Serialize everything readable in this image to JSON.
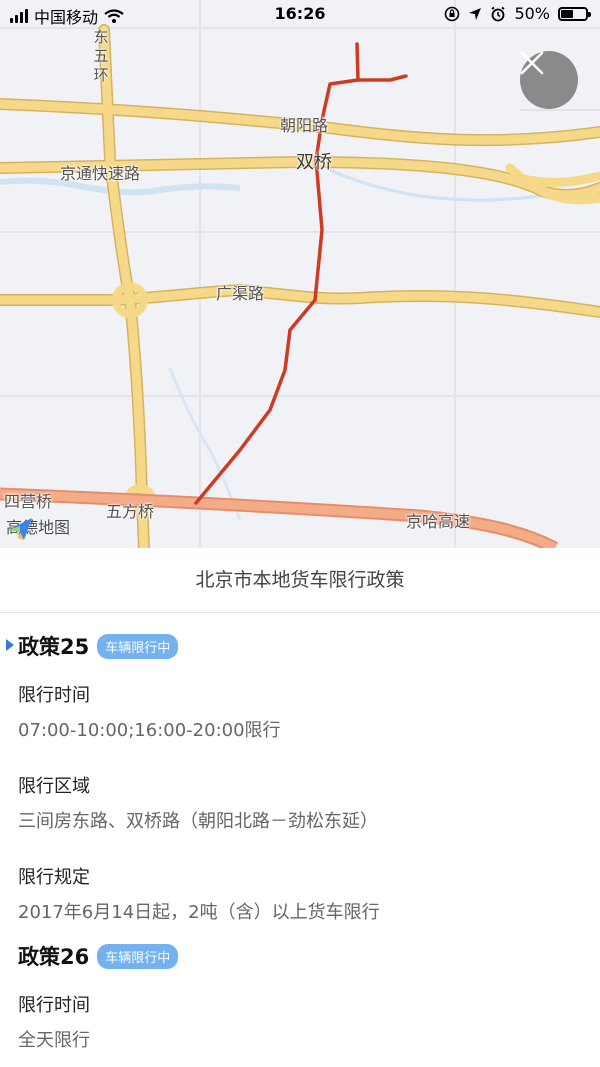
{
  "status_bar": {
    "carrier": "中国移动",
    "time": "16:26",
    "battery": "50%",
    "battery_level": 0.5
  },
  "map": {
    "labels": {
      "chaoyang_road": "朝阳路",
      "jingtong_expressway": "京通快速路",
      "shuangqiao": "双桥",
      "guangqu_road": "广渠路",
      "siyingqiao": "四营桥",
      "wufangqiao": "五方桥",
      "jingha_expressway": "京哈高速",
      "east_fifth_ring": "东五环"
    },
    "logo_text": "高德地图",
    "close_icon": "close-icon"
  },
  "panel": {
    "title": "北京市本地货车限行政策",
    "policies": [
      {
        "name": "政策25",
        "badge": "车辆限行中",
        "time_label": "限行时间",
        "time_value": "07:00-10:00;16:00-20:00限行",
        "area_label": "限行区域",
        "area_value": "三间房东路、双桥路（朝阳北路－劲松东延）",
        "rule_label": "限行规定",
        "rule_value": "2017年6月14日起，2吨（含）以上货车限行"
      },
      {
        "name": "政策26",
        "badge": "车辆限行中",
        "time_label": "限行时间",
        "time_value": "全天限行"
      }
    ]
  },
  "colors": {
    "road_yellow": "#f2cf7e",
    "highway_orange": "#f0a37c",
    "route_red": "#cf3a25",
    "badge_blue": "#73b2ee"
  }
}
